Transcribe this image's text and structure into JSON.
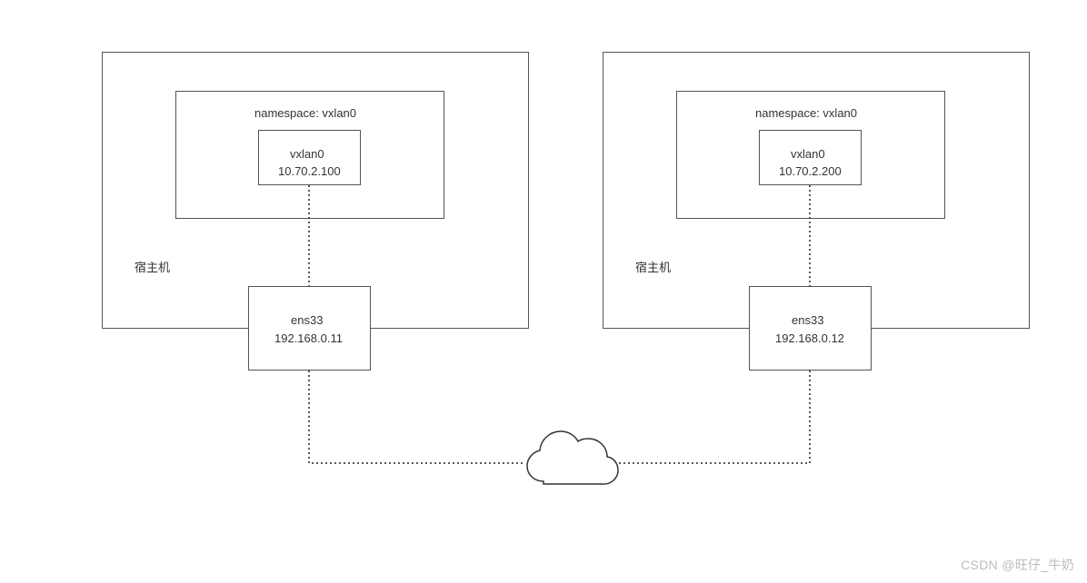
{
  "hosts": [
    {
      "host_label": "宿主机",
      "namespace_title": "namespace: vxlan0",
      "vxlan_iface": "vxlan0",
      "vxlan_ip": "10.70.2.100",
      "phys_iface": "ens33",
      "phys_ip": "192.168.0.11"
    },
    {
      "host_label": "宿主机",
      "namespace_title": "namespace: vxlan0",
      "vxlan_iface": "vxlan0",
      "vxlan_ip": "10.70.2.200",
      "phys_iface": "ens33",
      "phys_ip": "192.168.0.12"
    }
  ],
  "watermark": "CSDN @旺仔_牛奶"
}
